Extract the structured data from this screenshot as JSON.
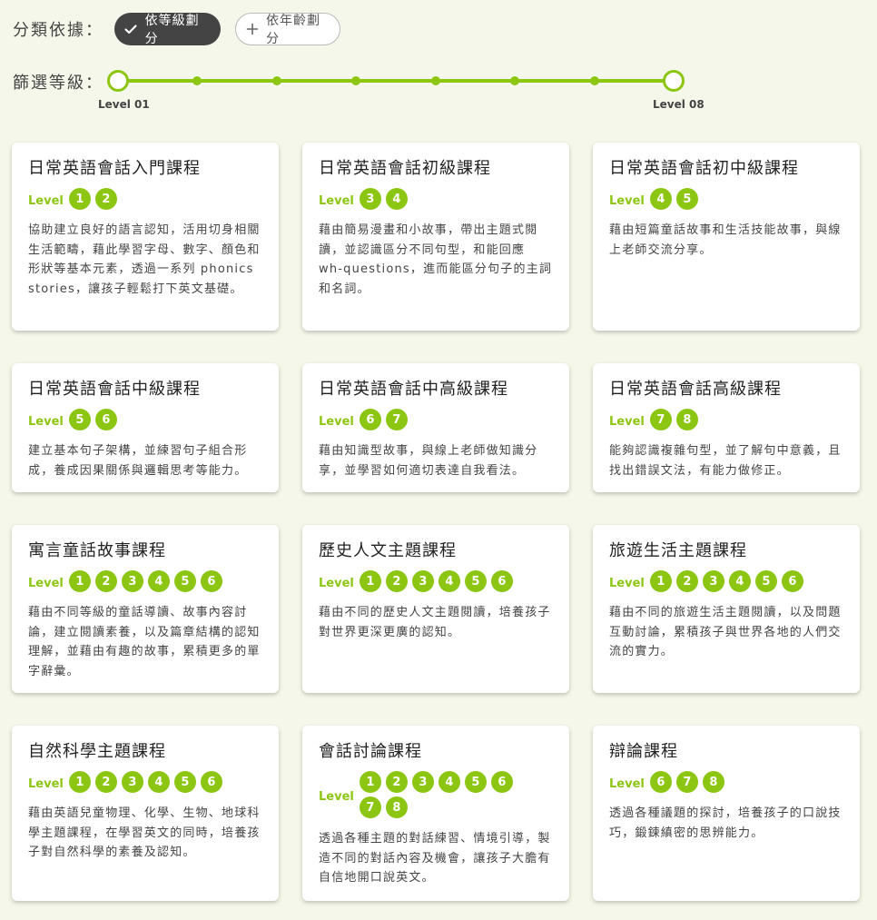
{
  "filter": {
    "sort_label": "分類依據：",
    "level_label": "篩選等級：",
    "option_by_level": "依等級劃分",
    "option_by_age": "依年齡劃分",
    "slider": {
      "min_label": "Level 01",
      "max_label": "Level 08",
      "selected_min": 1,
      "selected_max": 8,
      "steps": 8
    }
  },
  "level_word": "Level",
  "colors": {
    "accent": "#8cc612",
    "chip_active": "#444444",
    "background": "#f4f7e9"
  },
  "courses": [
    {
      "title": "日常英語會話入門課程",
      "levels": [
        "1",
        "2"
      ],
      "description": "協助建立良好的語言認知，活用切身相關生活範疇，藉此學習字母、數字、顏色和形狀等基本元素，透過一系列 phonics stories，讓孩子輕鬆打下英文基礎。"
    },
    {
      "title": "日常英語會話初級課程",
      "levels": [
        "3",
        "4"
      ],
      "description": "藉由簡易漫畫和小故事，帶出主題式閱讀，並認識區分不同句型，和能回應 wh-questions，進而能區分句子的主詞和名詞。"
    },
    {
      "title": "日常英語會話初中級課程",
      "levels": [
        "4",
        "5"
      ],
      "description": "藉由短篇童話故事和生活技能故事，與線上老師交流分享。"
    },
    {
      "title": "日常英語會話中級課程",
      "levels": [
        "5",
        "6"
      ],
      "description": "建立基本句子架構，並練習句子組合形成，養成因果關係與邏輯思考等能力。"
    },
    {
      "title": "日常英語會話中高級課程",
      "levels": [
        "6",
        "7"
      ],
      "description": "藉由知識型故事，與線上老師做知識分享，並學習如何適切表達自我看法。"
    },
    {
      "title": "日常英語會話高級課程",
      "levels": [
        "7",
        "8"
      ],
      "description": "能夠認識複雜句型，並了解句中意義，且找出錯誤文法，有能力做修正。"
    },
    {
      "title": "寓言童話故事課程",
      "levels": [
        "1",
        "2",
        "3",
        "4",
        "5",
        "6"
      ],
      "description": "藉由不同等級的童話導讀、故事內容討論，建立閱讀素養，以及篇章結構的認知理解，並藉由有趣的故事，累積更多的單字辭彙。"
    },
    {
      "title": "歷史人文主題課程",
      "levels": [
        "1",
        "2",
        "3",
        "4",
        "5",
        "6"
      ],
      "description": "藉由不同的歷史人文主題閱讀，培養孩子對世界更深更廣的認知。"
    },
    {
      "title": "旅遊生活主題課程",
      "levels": [
        "1",
        "2",
        "3",
        "4",
        "5",
        "6"
      ],
      "description": "藉由不同的旅遊生活主題閱讀，以及問題互動討論，累積孩子與世界各地的人們交流的實力。"
    },
    {
      "title": "自然科學主題課程",
      "levels": [
        "1",
        "2",
        "3",
        "4",
        "5",
        "6"
      ],
      "description": "藉由英語兒童物理、化學、生物、地球科學主題課程，在學習英文的同時，培養孩子對自然科學的素養及認知。"
    },
    {
      "title": "會話討論課程",
      "levels": [
        "1",
        "2",
        "3",
        "4",
        "5",
        "6",
        "7",
        "8"
      ],
      "description": "透過各種主題的對話練習、情境引導，製造不同的對話內容及機會，讓孩子大膽有自信地開口說英文。"
    },
    {
      "title": "辯論課程",
      "levels": [
        "6",
        "7",
        "8"
      ],
      "description": "透過各種議題的探討，培養孩子的口說技巧，鍛鍊縝密的思辨能力。"
    }
  ]
}
